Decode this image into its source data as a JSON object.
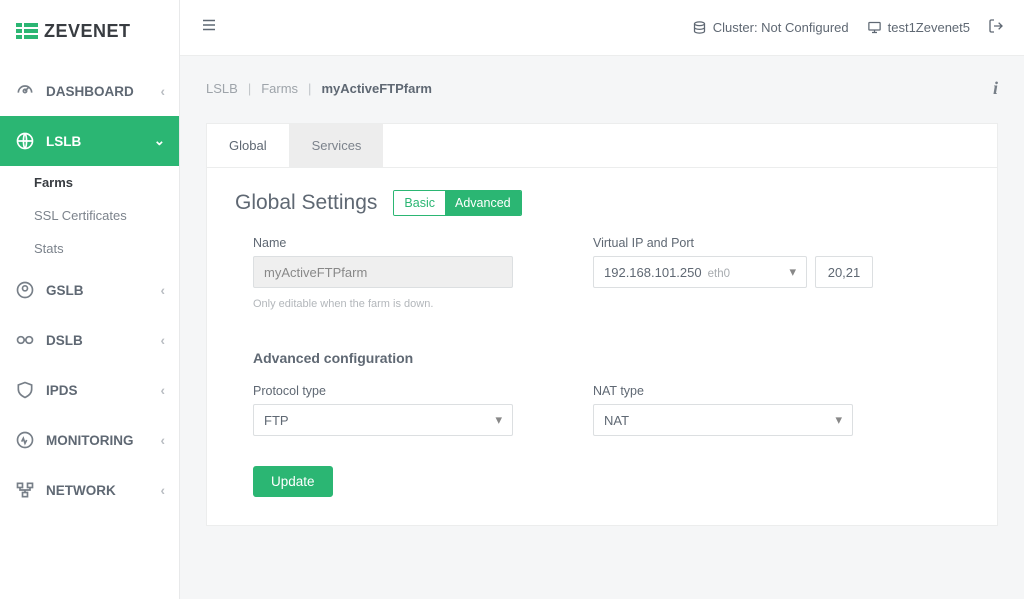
{
  "brand": {
    "name": "ZEVENET"
  },
  "topbar": {
    "cluster_label": "Cluster: Not Configured",
    "host": "test1Zevenet5"
  },
  "sidebar": {
    "items": [
      {
        "label": "DASHBOARD"
      },
      {
        "label": "LSLB",
        "sub": [
          {
            "label": "Farms",
            "sel": true
          },
          {
            "label": "SSL Certificates"
          },
          {
            "label": "Stats"
          }
        ]
      },
      {
        "label": "GSLB"
      },
      {
        "label": "DSLB"
      },
      {
        "label": "IPDS"
      },
      {
        "label": "MONITORING"
      },
      {
        "label": "NETWORK"
      }
    ]
  },
  "breadcrumb": {
    "a": "LSLB",
    "b": "Farms",
    "current": "myActiveFTPfarm"
  },
  "tabs": {
    "global": "Global",
    "services": "Services"
  },
  "section": {
    "title": "Global Settings",
    "basic": "Basic",
    "advanced": "Advanced"
  },
  "form": {
    "name_label": "Name",
    "name_value": "myActiveFTPfarm",
    "name_hint": "Only editable when the farm is down.",
    "vip_label": "Virtual IP and Port",
    "vip_value": "192.168.101.250",
    "vip_iface": "eth0",
    "vip_port": "20,21",
    "advanced_heading": "Advanced configuration",
    "proto_label": "Protocol type",
    "proto_value": "FTP",
    "nat_label": "NAT type",
    "nat_value": "NAT",
    "update": "Update"
  }
}
